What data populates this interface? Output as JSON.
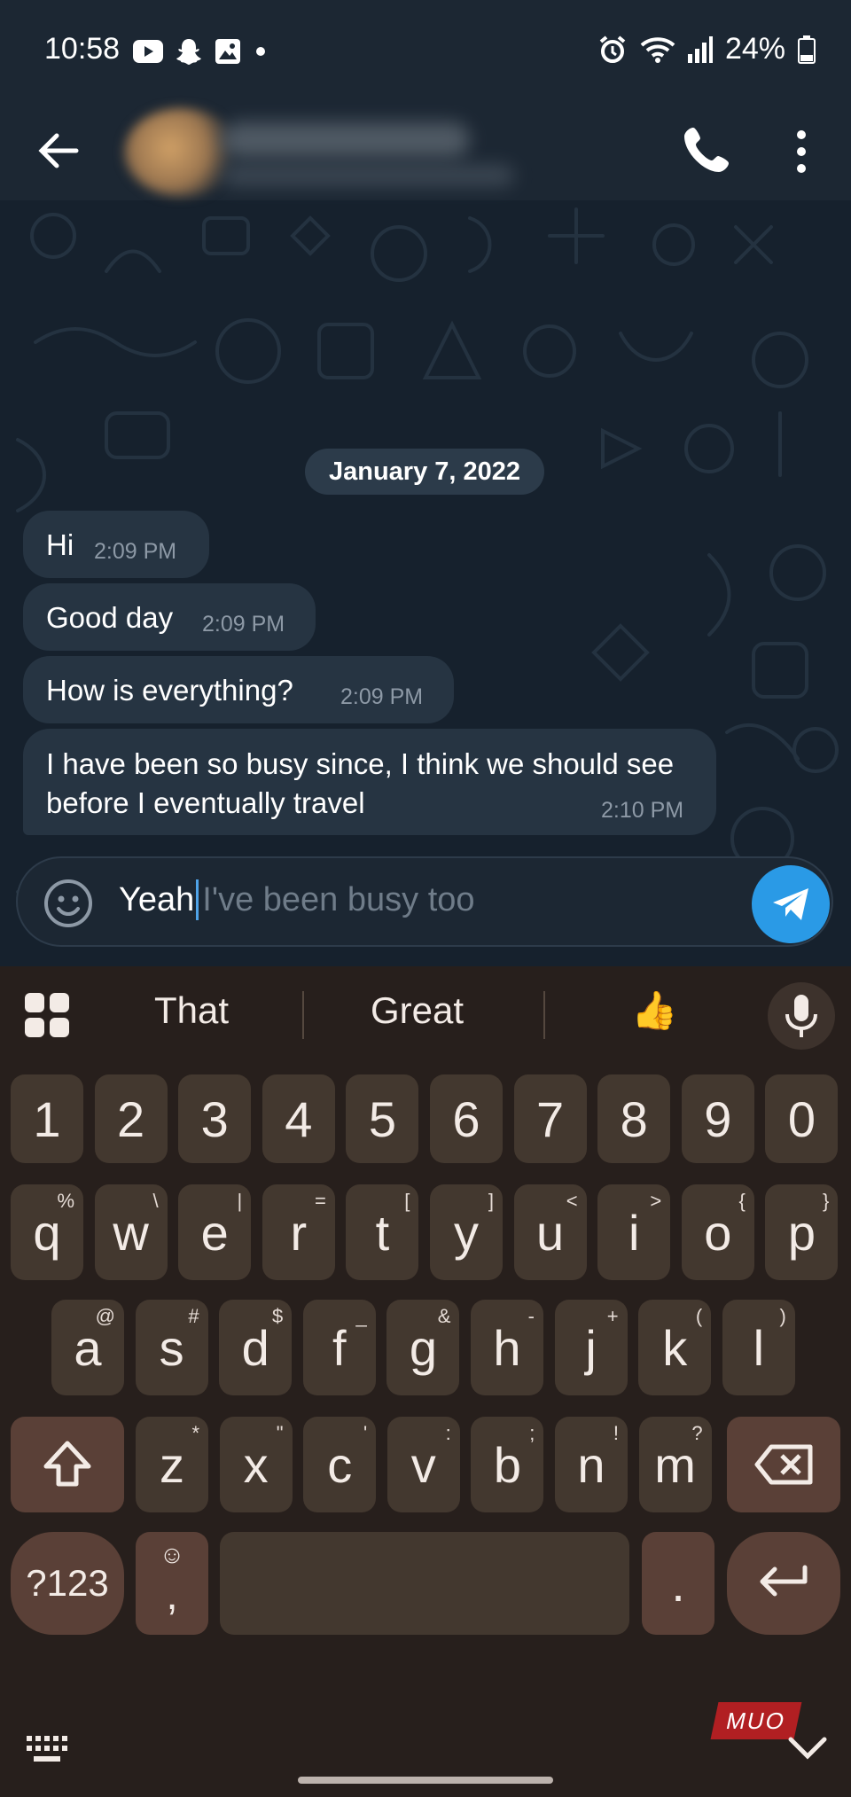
{
  "status_bar": {
    "time": "10:58",
    "battery": "24%"
  },
  "chat": {
    "date_chip": "January 7, 2022",
    "messages": [
      {
        "text": "Hi",
        "time": "2:09 PM"
      },
      {
        "text": "Good day",
        "time": "2:09 PM"
      },
      {
        "text": "How is everything?",
        "time": "2:09 PM"
      },
      {
        "text": "I have been so busy since, I think we should see before I eventually travel",
        "time": "2:10 PM"
      }
    ]
  },
  "composer": {
    "typed": "Yeah",
    "suggestion": "I've been busy too"
  },
  "keyboard": {
    "suggestions": [
      "That",
      "Great",
      "👍"
    ],
    "number_row": [
      "1",
      "2",
      "3",
      "4",
      "5",
      "6",
      "7",
      "8",
      "9",
      "0"
    ],
    "row1": [
      {
        "k": "q",
        "s": "%"
      },
      {
        "k": "w",
        "s": "\\"
      },
      {
        "k": "e",
        "s": "|"
      },
      {
        "k": "r",
        "s": "="
      },
      {
        "k": "t",
        "s": "["
      },
      {
        "k": "y",
        "s": "]"
      },
      {
        "k": "u",
        "s": "<"
      },
      {
        "k": "i",
        "s": ">"
      },
      {
        "k": "o",
        "s": "{"
      },
      {
        "k": "p",
        "s": "}"
      }
    ],
    "row2": [
      {
        "k": "a",
        "s": "@"
      },
      {
        "k": "s",
        "s": "#"
      },
      {
        "k": "d",
        "s": "$"
      },
      {
        "k": "f",
        "s": "_"
      },
      {
        "k": "g",
        "s": "&"
      },
      {
        "k": "h",
        "s": "-"
      },
      {
        "k": "j",
        "s": "+"
      },
      {
        "k": "k",
        "s": "("
      },
      {
        "k": "l",
        "s": ")"
      }
    ],
    "row3": [
      {
        "k": "z",
        "s": "*"
      },
      {
        "k": "x",
        "s": "\""
      },
      {
        "k": "c",
        "s": "'"
      },
      {
        "k": "v",
        "s": ":"
      },
      {
        "k": "b",
        "s": ";"
      },
      {
        "k": "n",
        "s": "!"
      },
      {
        "k": "m",
        "s": "?"
      }
    ],
    "symbols_label": "?123",
    "comma_key": ",",
    "period_key": "."
  },
  "watermark": "MUO"
}
